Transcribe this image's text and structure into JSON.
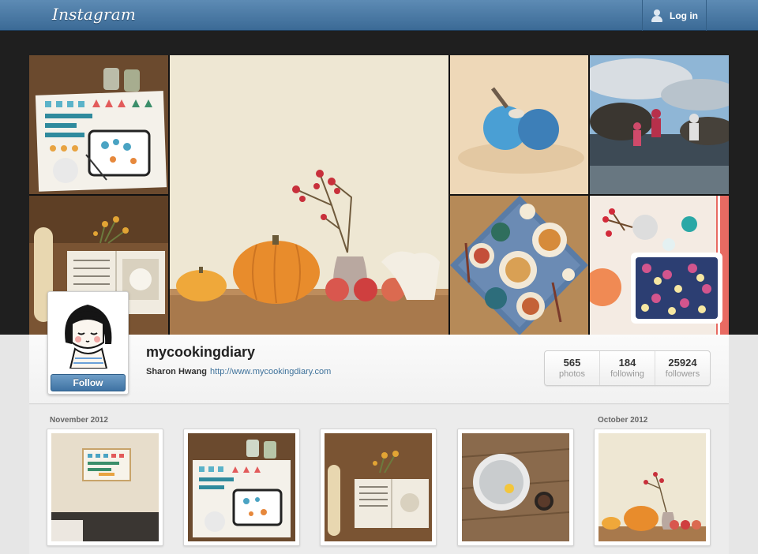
{
  "header": {
    "logo_text": "Instagram",
    "login_label": "Log in",
    "login_icon": "user-icon"
  },
  "profile": {
    "username": "mycookingdiary",
    "full_name": "Sharon Hwang",
    "website": "http://www.mycookingdiary.com",
    "follow_label": "Follow"
  },
  "stats": [
    {
      "value": "565",
      "label": "photos"
    },
    {
      "value": "184",
      "label": "following"
    },
    {
      "value": "25924",
      "label": "followers"
    }
  ],
  "feed": {
    "months": [
      "November 2012",
      "October 2012"
    ]
  },
  "colors": {
    "header_blue": "#3f729b",
    "link_blue": "#3f729b",
    "follow_button": "#4f83b3"
  }
}
